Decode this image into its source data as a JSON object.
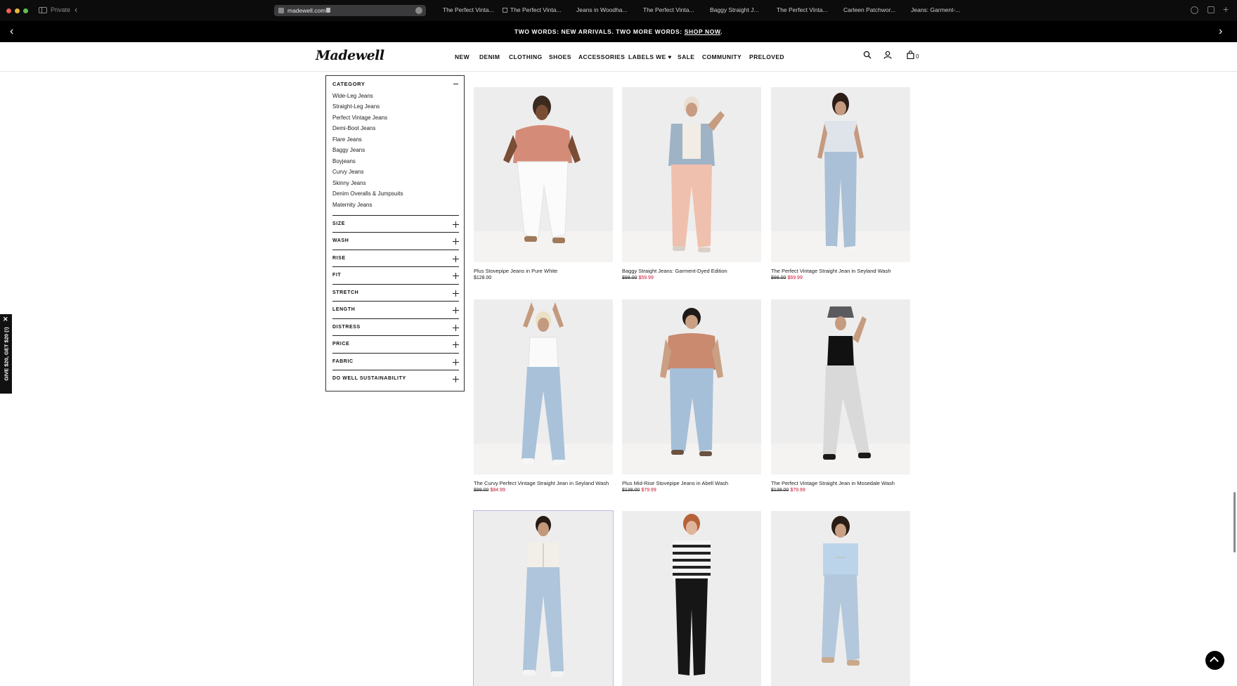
{
  "browser": {
    "private_label": "Private",
    "url": "madewell.com",
    "tabs": [
      "The Perfect Vinta...",
      "The Perfect Vinta...",
      "Jeans in Woodha...",
      "The Perfect Vinta...",
      "Baggy Straight J...",
      "The Perfect Vinta...",
      "Carleen Patchwor...",
      "Jeans: Garment-..."
    ]
  },
  "promo": {
    "text": "TWO WORDS: NEW ARRIVALS. TWO MORE WORDS: ",
    "link": "SHOP NOW",
    "suffix": "."
  },
  "header": {
    "logo": "Madewell",
    "nav": [
      "NEW",
      "DENIM",
      "CLOTHING",
      "SHOES",
      "ACCESSORIES",
      "LABELS WE ♥",
      "SALE",
      "COMMUNITY",
      "PRELOVED"
    ],
    "bag_count": "0"
  },
  "filters": {
    "category_heading": "CATEGORY",
    "categories": [
      "Wide-Leg Jeans",
      "Straight-Leg Jeans",
      "Perfect Vintage Jeans",
      "Demi-Boot Jeans",
      "Flare Jeans",
      "Baggy Jeans",
      "Boyjeans",
      "Curvy Jeans",
      "Skinny Jeans",
      "Denim Overalls & Jumpsuits",
      "Maternity Jeans"
    ],
    "facets": [
      "SIZE",
      "WASH",
      "RISE",
      "FIT",
      "STRETCH",
      "LENGTH",
      "DISTRESS",
      "PRICE",
      "FABRIC",
      "DO WELL SUSTAINABILITY"
    ]
  },
  "side_promo": {
    "text": "GIVE $20, GET $20 (!)",
    "close": "✕"
  },
  "products": [
    {
      "name": "Plus Stovepipe Jeans in Pure White",
      "price": "$128.00",
      "original": "",
      "sale": ""
    },
    {
      "name": "Baggy Straight Jeans: Garment-Dyed Edition",
      "price": "",
      "original": "$98.00",
      "sale": "$59.99"
    },
    {
      "name": "The Perfect Vintage Straight Jean in Seyland Wash",
      "price": "",
      "original": "$98.00",
      "sale": "$69.99"
    },
    {
      "name": "The Curvy Perfect Vintage Straight Jean in Seyland Wash",
      "price": "",
      "original": "$98.00",
      "sale": "$84.99"
    },
    {
      "name": "Plus Mid-Rise Stovepipe Jeans in Abell Wash",
      "price": "",
      "original": "$138.00",
      "sale": "$79.99"
    },
    {
      "name": "The Perfect Vintage Straight Jean in Mosedale Wash",
      "price": "",
      "original": "$138.00",
      "sale": "$79.99"
    },
    {
      "name": "",
      "price": "",
      "original": "",
      "sale": ""
    },
    {
      "name": "",
      "price": "",
      "original": "",
      "sale": ""
    },
    {
      "name": "",
      "price": "",
      "original": "",
      "sale": ""
    }
  ],
  "colors": {
    "sale": "#c8102e",
    "promo_bg": "#000000",
    "accent": "#111111"
  }
}
